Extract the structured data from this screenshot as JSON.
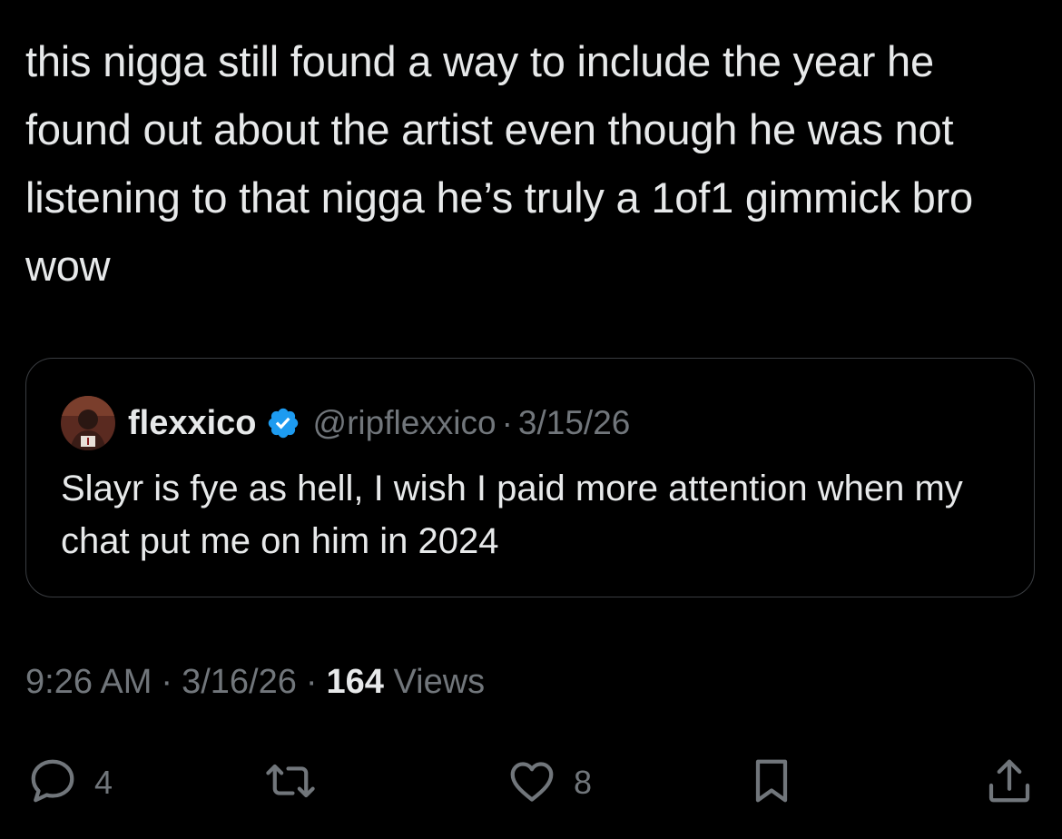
{
  "post": {
    "text": "this nigga still found a way to include the year he found out about the artist even though he was not listening to that nigga he’s truly a 1of1 gimmick bro wow"
  },
  "quote": {
    "name": "flexxico",
    "handle": "@ripflexxico",
    "separator": "·",
    "date": "3/15/26",
    "text": "Slayr is fye as hell, I wish I paid more attention when my chat put me on him in 2024",
    "verified_color": "#1d9bf0"
  },
  "meta": {
    "time": "9:26 AM",
    "separator": "·",
    "date": "3/16/26",
    "views_count": "164",
    "views_label": "Views"
  },
  "actions": {
    "replies": {
      "icon": "reply-icon",
      "count": "4"
    },
    "reposts": {
      "icon": "repost-icon"
    },
    "likes": {
      "icon": "heart-icon",
      "count": "8"
    },
    "bookmark": {
      "icon": "bookmark-icon"
    },
    "share": {
      "icon": "share-icon"
    }
  },
  "colors": {
    "background": "#000000",
    "text_primary": "#e7e9ea",
    "text_secondary": "#71767b",
    "border": "#3a3d41"
  }
}
